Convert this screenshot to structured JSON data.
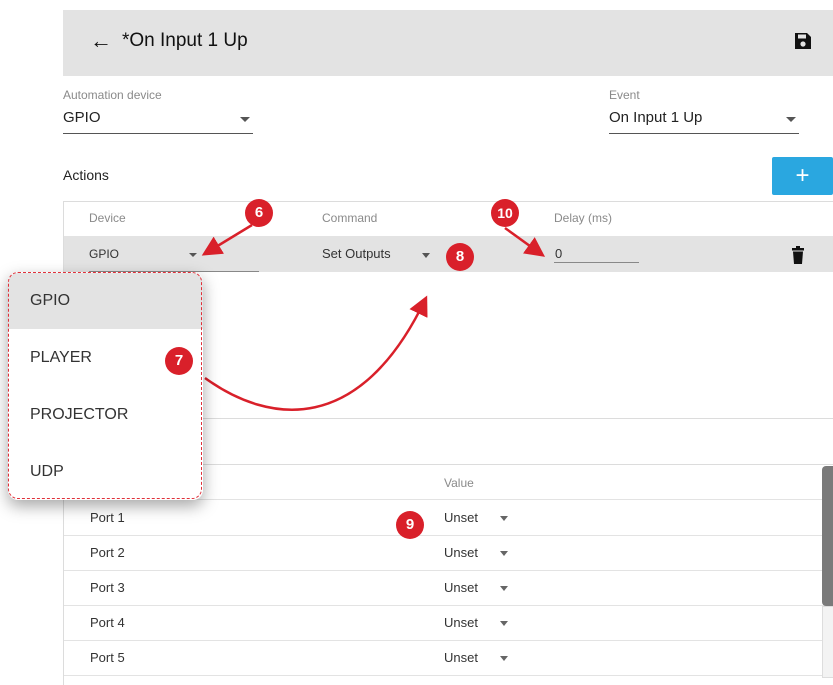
{
  "header": {
    "back_icon": "arrow-left-icon",
    "title": "*On Input 1 Up",
    "save_icon": "floppy-disk-icon"
  },
  "automation_device": {
    "label": "Automation device",
    "value": "GPIO"
  },
  "event": {
    "label": "Event",
    "value": "On Input 1 Up"
  },
  "actions": {
    "label": "Actions",
    "add_label": "+",
    "columns": {
      "device": "Device",
      "command": "Command",
      "delay": "Delay (ms)"
    },
    "row": {
      "device": "GPIO",
      "command": "Set Outputs",
      "delay": "0",
      "delete_icon": "trash-icon"
    }
  },
  "device_menu": {
    "options": [
      "GPIO",
      "PLAYER",
      "PROJECTOR",
      "UDP"
    ],
    "selected": "GPIO"
  },
  "outputs": {
    "value_header": "Value",
    "ports": [
      {
        "name": "Port 1",
        "value": "Unset"
      },
      {
        "name": "Port 2",
        "value": "Unset"
      },
      {
        "name": "Port 3",
        "value": "Unset"
      },
      {
        "name": "Port 4",
        "value": "Unset"
      },
      {
        "name": "Port 5",
        "value": "Unset"
      }
    ]
  },
  "callouts": [
    "6",
    "7",
    "8",
    "9",
    "10"
  ],
  "colors": {
    "accent": "#2aa7e0",
    "callout": "#d9202a",
    "header_bg": "#e3e3e3"
  }
}
